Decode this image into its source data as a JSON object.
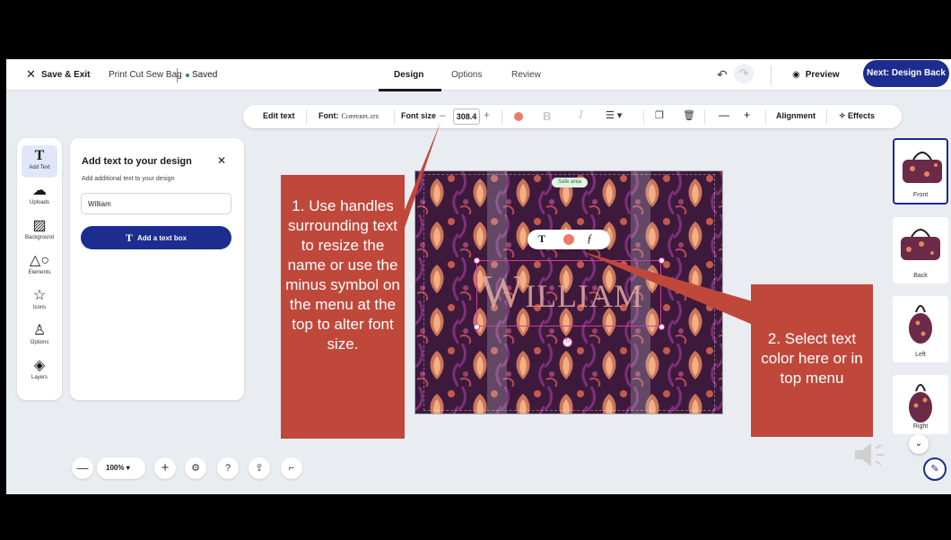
{
  "header": {
    "save_exit": "Save & Exit",
    "project_name": "Print Cut Sew Bag",
    "saved": "Saved",
    "tabs": [
      {
        "label": "Design",
        "active": true
      },
      {
        "label": "Options",
        "active": false
      },
      {
        "label": "Review",
        "active": false
      }
    ],
    "preview": "Preview",
    "next": "Next: Design Back"
  },
  "toolbar": {
    "edit_text": "Edit text",
    "font_label": "Font:",
    "font_name": "Copperplate",
    "font_size_label": "Font size",
    "font_size_value": "308.4",
    "alignment": "Alignment",
    "effects": "Effects",
    "text_color": "#ec7a6a"
  },
  "rail": {
    "items": [
      {
        "label": "Add Text",
        "icon": "text-icon"
      },
      {
        "label": "Uploads",
        "icon": "upload-cloud-icon"
      },
      {
        "label": "Background",
        "icon": "background-icon"
      },
      {
        "label": "Elements",
        "icon": "elements-icon"
      },
      {
        "label": "Icons",
        "icon": "star-icon"
      },
      {
        "label": "Options",
        "icon": "shirt-icon"
      },
      {
        "label": "Layers",
        "icon": "layers-icon"
      }
    ]
  },
  "panel": {
    "title": "Add text to your design",
    "subtitle": "Add additional text to your design",
    "input_value": "William",
    "add_button": "Add a text box"
  },
  "canvas": {
    "safe_area": "Safe area",
    "text": "William"
  },
  "callouts": {
    "one": "1. Use handles surrounding text to resize the name or use the minus symbol on the menu at the top to alter font size.",
    "two": "2. Select text color here or in top menu"
  },
  "views": [
    {
      "label": "Front",
      "active": true
    },
    {
      "label": "Back",
      "active": false
    },
    {
      "label": "Left",
      "active": false
    },
    {
      "label": "Right",
      "active": false
    }
  ],
  "bottom": {
    "zoom": "100%"
  },
  "colors": {
    "brand": "#1d2c8f",
    "callout": "#c0483b",
    "selection": "#d23d9a"
  }
}
